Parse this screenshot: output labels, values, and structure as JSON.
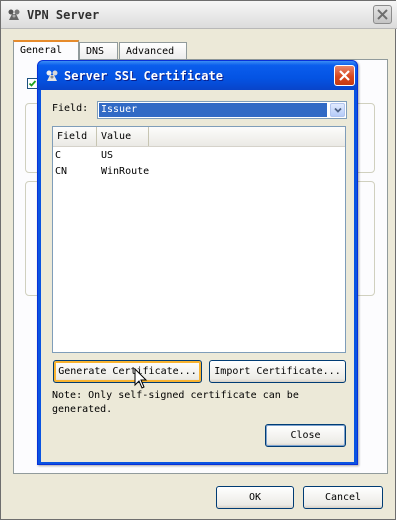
{
  "window": {
    "title": "VPN Server",
    "tabs": [
      {
        "label": "General",
        "active": true
      },
      {
        "label": "DNS",
        "active": false
      },
      {
        "label": "Advanced",
        "active": false
      }
    ],
    "ok_label": "OK",
    "cancel_label": "Cancel"
  },
  "dialog": {
    "title": "Server SSL Certificate",
    "field_label": "Field:",
    "field_selected": "Issuer",
    "columns": [
      "Field",
      "Value"
    ],
    "rows": [
      {
        "field": "C",
        "value": "US"
      },
      {
        "field": "CN",
        "value": "WinRoute"
      }
    ],
    "generate_label": "Generate Certificate...",
    "import_label": "Import Certificate...",
    "note": "Note: Only self-signed certificate can be generated.",
    "close_label": "Close"
  },
  "colors": {
    "dialog_title_blue": "#0a5ded",
    "selection_blue": "#316ac5",
    "close_red": "#d9481f",
    "tab_accent": "#e68b2c"
  },
  "icons": {
    "app": "kerio-logo-icon",
    "close": "close-x-icon",
    "dropdown": "chevron-down-icon",
    "cursor": "mouse-pointer-icon"
  }
}
